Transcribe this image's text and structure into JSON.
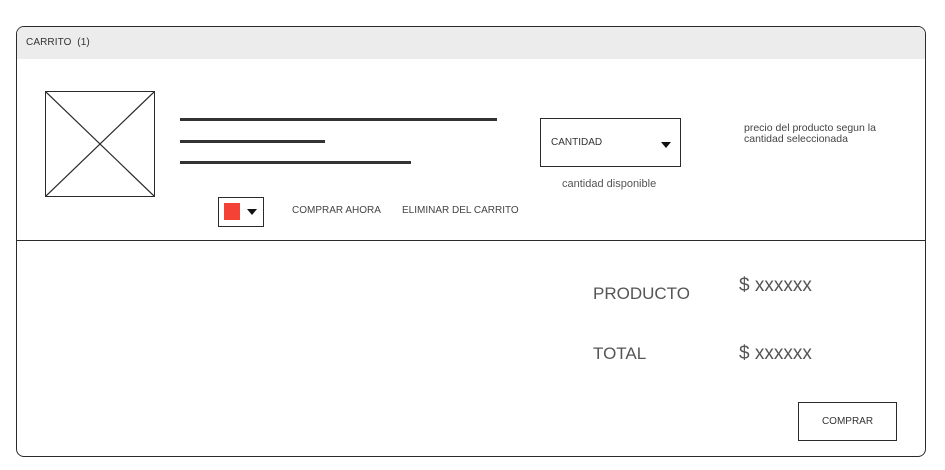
{
  "cart": {
    "title": "CARRITO",
    "count": "(1)"
  },
  "item": {
    "image_icon": "image-placeholder-icon",
    "color_swatch": "#f44336",
    "color_caret_icon": "caret-down-icon",
    "buy_now_label": "COMPRAR AHORA",
    "remove_label": "ELIMINAR DEL CARRITO",
    "quantity_label": "CANTIDAD",
    "quantity_caret_icon": "caret-down-icon",
    "quantity_available": "cantidad disponible",
    "price_note": "precio del producto segun la cantidad seleccionada"
  },
  "summary": {
    "product_label": "PRODUCTO",
    "product_value": "$ xxxxxx",
    "total_label": "TOTAL",
    "total_value": "$ xxxxxx",
    "buy_label": "COMPRAR"
  }
}
